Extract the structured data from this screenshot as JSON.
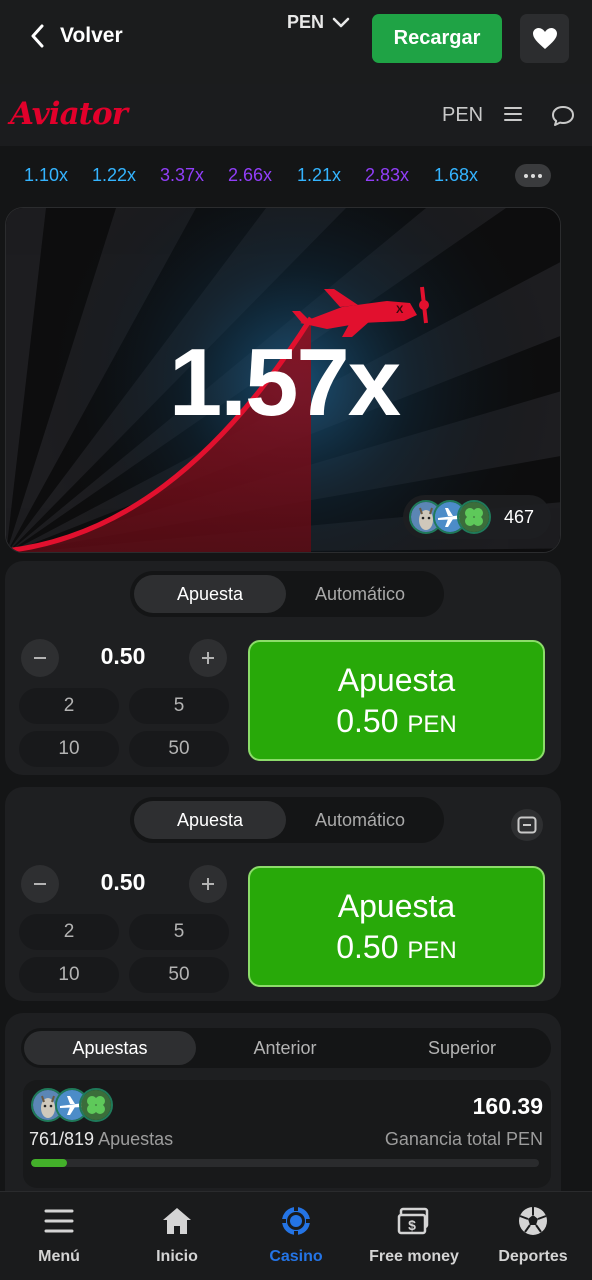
{
  "header": {
    "back_label": "Volver",
    "currency": "PEN",
    "recharge_label": "Recargar"
  },
  "game_header": {
    "logo": "Aviator",
    "currency": "PEN"
  },
  "history": [
    {
      "value": "1.10x",
      "color": "#34b4ff"
    },
    {
      "value": "1.22x",
      "color": "#34b4ff"
    },
    {
      "value": "3.37x",
      "color": "#913ef8"
    },
    {
      "value": "2.66x",
      "color": "#913ef8"
    },
    {
      "value": "1.21x",
      "color": "#34b4ff"
    },
    {
      "value": "2.83x",
      "color": "#913ef8"
    },
    {
      "value": "1.68x",
      "color": "#34b4ff"
    }
  ],
  "game": {
    "multiplier": "1.57x",
    "players_count": "467"
  },
  "bet_panels": [
    {
      "tabs": [
        "Apuesta",
        "Automático"
      ],
      "amount": "0.50",
      "quick": [
        "2",
        "5",
        "10",
        "50"
      ],
      "button_title": "Apuesta",
      "button_amount": "0.50",
      "button_currency": "PEN"
    },
    {
      "tabs": [
        "Apuesta",
        "Automático"
      ],
      "amount": "0.50",
      "quick": [
        "2",
        "5",
        "10",
        "50"
      ],
      "button_title": "Apuesta",
      "button_amount": "0.50",
      "button_currency": "PEN"
    }
  ],
  "bets": {
    "tabs": [
      "Apuestas",
      "Anterior",
      "Superior"
    ],
    "count": "761/819",
    "count_label": "Apuestas",
    "total": "160.39",
    "total_label": "Ganancia total PEN",
    "progress": 0.07
  },
  "nav": [
    {
      "label": "Menú",
      "icon": "menu-icon"
    },
    {
      "label": "Inicio",
      "icon": "home-icon"
    },
    {
      "label": "Casino",
      "icon": "casino-icon"
    },
    {
      "label": "Free money",
      "icon": "free-money-icon"
    },
    {
      "label": "Deportes",
      "icon": "soccer-ball-icon"
    }
  ],
  "colors": {
    "accent_green": "#28a909",
    "recharge_green": "#1fa345",
    "brand_red": "#e2002b",
    "nav_active": "#2474e5"
  }
}
